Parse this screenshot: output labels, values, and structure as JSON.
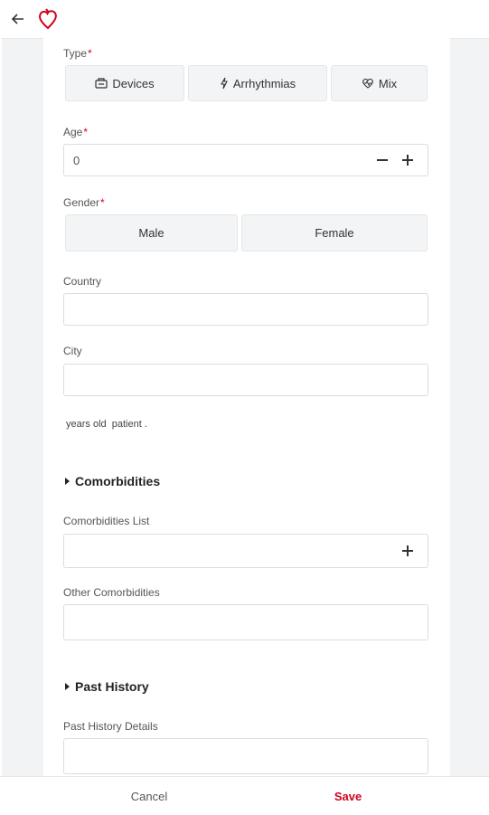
{
  "topbar": {
    "back_icon": "arrow-left-icon",
    "logo_icon": "heart-logo-icon"
  },
  "form": {
    "type": {
      "label": "Type",
      "required": "*",
      "options": [
        "Devices",
        "Arrhythmias",
        "Mix"
      ]
    },
    "age": {
      "label": "Age",
      "required": "*",
      "value": "0"
    },
    "gender": {
      "label": "Gender",
      "required": "*",
      "options": [
        "Male",
        "Female"
      ]
    },
    "country": {
      "label": "Country",
      "value": ""
    },
    "city": {
      "label": "City",
      "value": ""
    },
    "summary": "years old  patient ."
  },
  "comorbidities": {
    "title": "Comorbidities",
    "list_label": "Comorbidities List",
    "other_label": "Other Comorbidities"
  },
  "past_history": {
    "title": "Past History",
    "details_label": "Past History Details"
  },
  "actions": {
    "cancel": "Cancel",
    "save": "Save"
  },
  "colors": {
    "accent": "#d0021b",
    "page_bg": "#f2f3f4",
    "field_bg": "#f3f4f5"
  }
}
